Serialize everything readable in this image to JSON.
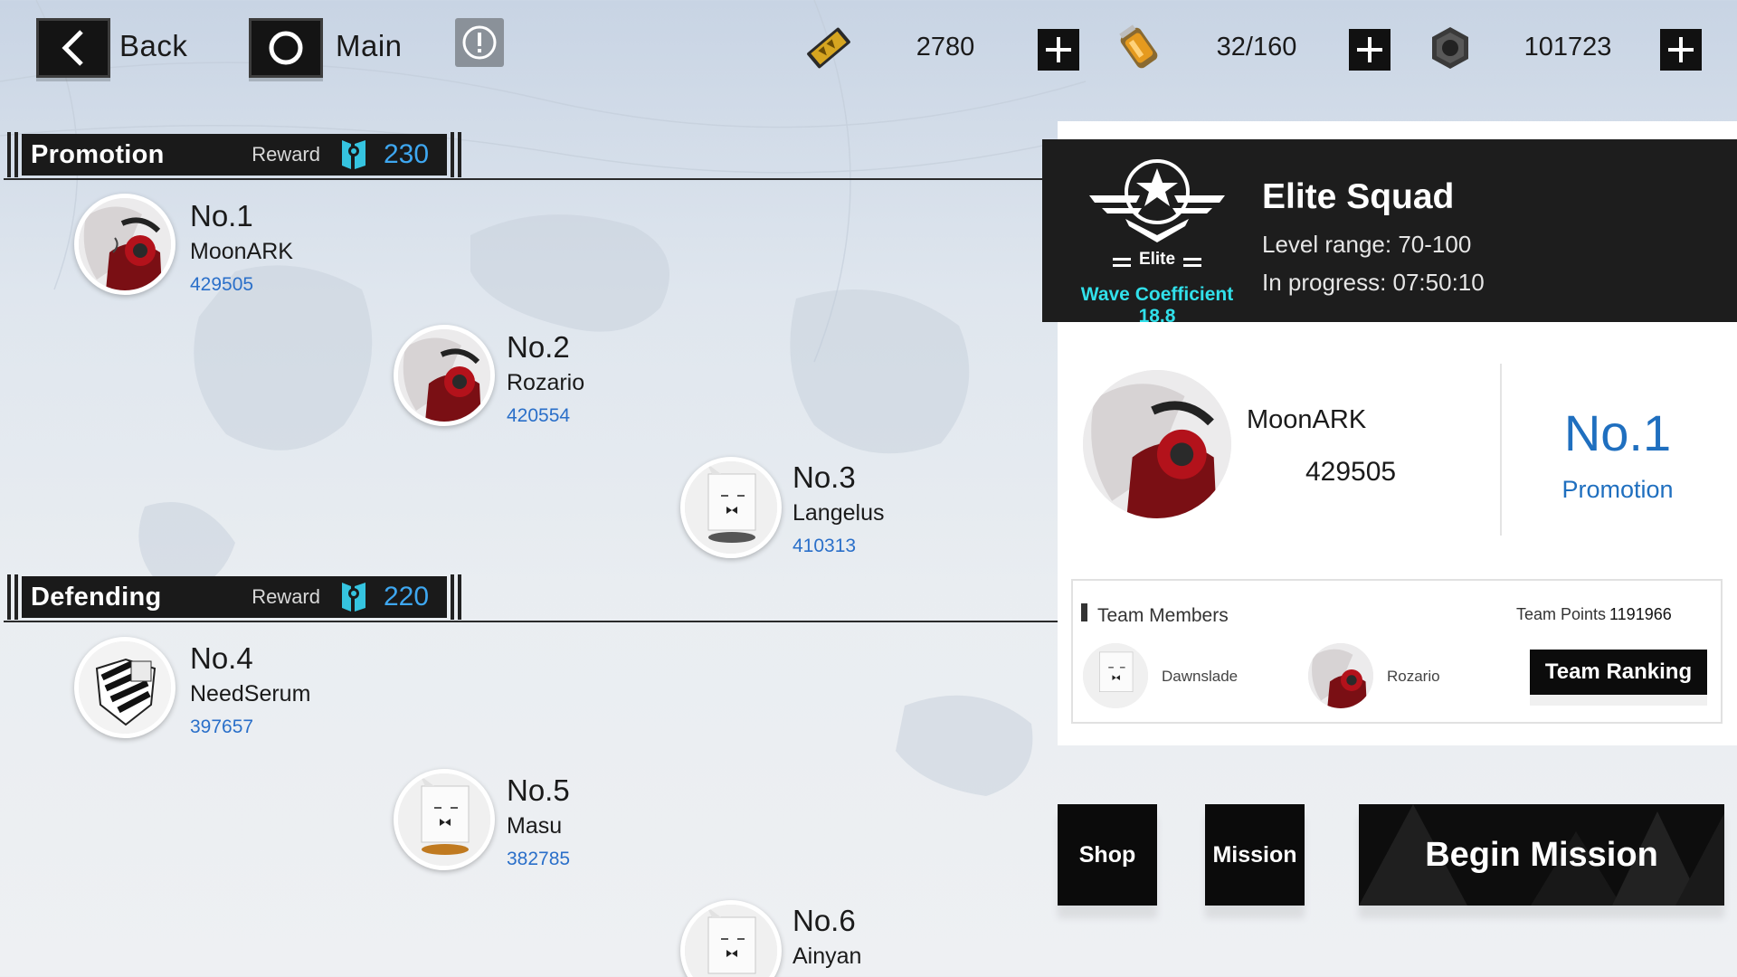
{
  "topbar": {
    "back_label": "Back",
    "main_label": "Main",
    "resources": [
      {
        "icon": "ticket-icon",
        "value": "2780"
      },
      {
        "icon": "energy-canister-icon",
        "value": "32/160"
      },
      {
        "icon": "hex-nut-icon",
        "value": "101723"
      }
    ]
  },
  "sections": {
    "promotion": {
      "title": "Promotion",
      "reward_label": "Reward",
      "reward_value": "230"
    },
    "defending": {
      "title": "Defending",
      "reward_label": "Reward",
      "reward_value": "220"
    }
  },
  "rankings": [
    {
      "no": "No.1",
      "name": "MoonARK",
      "score": "429505",
      "avatar": "red-headphone-girl"
    },
    {
      "no": "No.2",
      "name": "Rozario",
      "score": "420554",
      "avatar": "red-headphone-girl"
    },
    {
      "no": "No.3",
      "name": "Langelus",
      "score": "410313",
      "avatar": "white-box-robot"
    },
    {
      "no": "No.4",
      "name": "NeedSerum",
      "score": "397657",
      "avatar": "black-emblem"
    },
    {
      "no": "No.5",
      "name": "Masu",
      "score": "382785",
      "avatar": "white-box-robot"
    },
    {
      "no": "No.6",
      "name": "Ainyan",
      "score": "",
      "avatar": "white-box-robot"
    }
  ],
  "squad": {
    "title": "Elite Squad",
    "emblem_label": "Elite",
    "wave_coefficient": "Wave Coefficient 18.8",
    "level_range": "Level range: 70-100",
    "in_progress": "In progress: 07:50:10"
  },
  "me": {
    "name": "MoonARK",
    "score": "429505",
    "rank": "No.1",
    "tier": "Promotion"
  },
  "team": {
    "title": "Team Members",
    "points_label": "Team Points",
    "points_value": "1191966",
    "members": [
      {
        "name": "Dawnslade",
        "avatar": "white-box-robot"
      },
      {
        "name": "Rozario",
        "avatar": "red-headphone-girl"
      }
    ],
    "ranking_button": "Team Ranking"
  },
  "actions": {
    "shop": "Shop",
    "mission": "Mission",
    "begin": "Begin Mission"
  },
  "colors": {
    "accent_blue": "#1f6fbf",
    "score_blue": "#2a6fc9",
    "reward_blue": "#3ea7f0",
    "wave_cyan": "#31e0ea",
    "panel_dark": "#1d1d1d"
  }
}
